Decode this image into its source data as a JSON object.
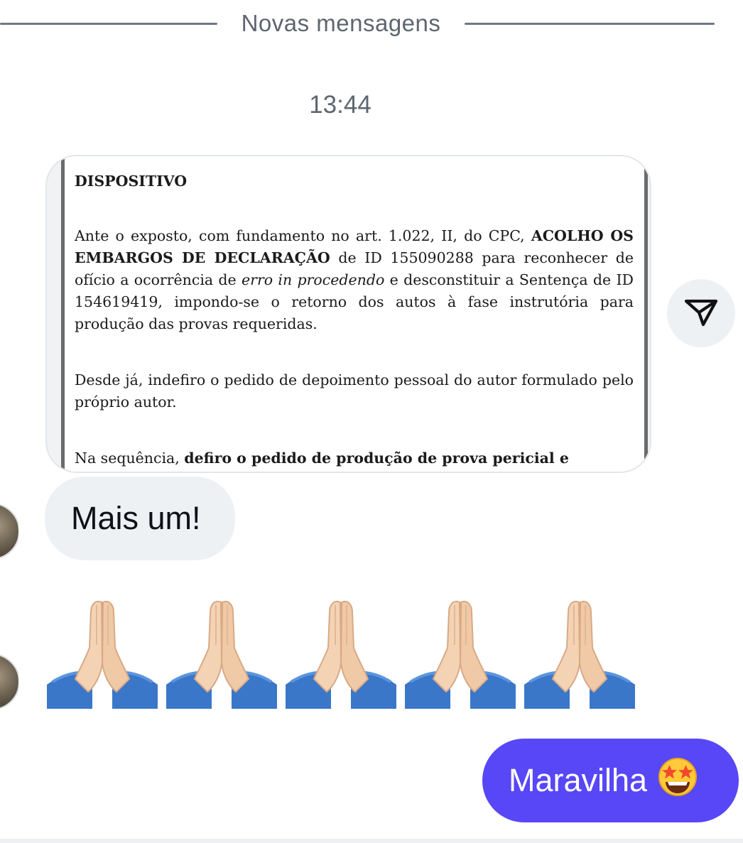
{
  "divider": {
    "label": "Novas mensagens"
  },
  "timestamp": "13:44",
  "document": {
    "heading": "DISPOSITIVO",
    "p1": {
      "t1": "Ante o exposto, com fundamento no art. 1.022, II, do CPC, ",
      "b1": "ACOLHO OS EMBARGOS DE DECLARAÇÃO",
      "t2": " de ID 155090288 para reconhecer de ofício a ocorrência de ",
      "i1": "erro in procedendo",
      "t3": " e desconstituir a Sentença de ID 154619419, impondo-se o retorno dos autos à fase instrutória para produção das provas requeridas."
    },
    "p2": "Desde já, indefiro o pedido de depoimento pessoal do autor formulado pelo próprio autor.",
    "p3": {
      "t1": "Na sequência, ",
      "b1": "defiro o pedido de produção de prova pericial e NOMEIO"
    }
  },
  "messages": {
    "received_text": "Mais um!",
    "emoji_count": 5,
    "sent_text": "Maravilha",
    "sent_emoji": "star-struck-emoji"
  },
  "icons": {
    "share": "send-paper-plane-icon",
    "emoji": "folded-hands-emoji"
  },
  "colors": {
    "sent_bubble": "#5847f6",
    "received_bubble": "#eef1f4",
    "muted_text": "#5d6670"
  }
}
